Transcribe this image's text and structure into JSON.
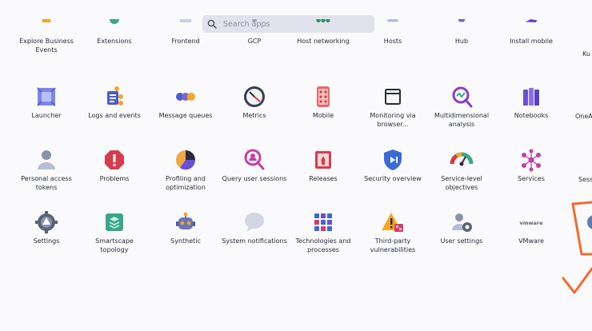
{
  "search": {
    "placeholder": "Search apps",
    "value": ""
  },
  "rows": [
    [
      {
        "label": "Explore Business Events",
        "icon": "business-events-icon"
      },
      {
        "label": "Extensions",
        "icon": "extensions-icon"
      },
      {
        "label": "Frontend",
        "icon": "frontend-icon"
      },
      {
        "label": "GCP",
        "icon": "gcp-icon"
      },
      {
        "label": "Host networking",
        "icon": "host-networking-icon"
      },
      {
        "label": "Hosts",
        "icon": "hosts-icon"
      },
      {
        "label": "Hub",
        "icon": "hub-icon"
      },
      {
        "label": "Install mobile",
        "icon": "install-mobile-icon"
      }
    ],
    [
      {
        "label": "Launcher",
        "icon": "launcher-icon"
      },
      {
        "label": "Logs and events",
        "icon": "logs-icon"
      },
      {
        "label": "Message queues",
        "icon": "message-queues-icon"
      },
      {
        "label": "Metrics",
        "icon": "metrics-icon"
      },
      {
        "label": "Mobile",
        "icon": "mobile-icon"
      },
      {
        "label": "Monitoring via browser...",
        "icon": "browser-monitor-icon"
      },
      {
        "label": "Multidimensional analysis",
        "icon": "multidimensional-icon"
      },
      {
        "label": "Notebooks",
        "icon": "notebooks-icon"
      }
    ],
    [
      {
        "label": "Personal access tokens",
        "icon": "access-tokens-icon"
      },
      {
        "label": "Problems",
        "icon": "problems-icon"
      },
      {
        "label": "Profiling and optimization",
        "icon": "profiling-icon"
      },
      {
        "label": "Query user sessions",
        "icon": "query-sessions-icon"
      },
      {
        "label": "Releases",
        "icon": "releases-icon"
      },
      {
        "label": "Security overview",
        "icon": "security-icon"
      },
      {
        "label": "Service-level objectives",
        "icon": "slo-icon"
      },
      {
        "label": "Services",
        "icon": "services-icon"
      }
    ],
    [
      {
        "label": "Settings",
        "icon": "settings-icon"
      },
      {
        "label": "Smartscape topology",
        "icon": "smartscape-icon"
      },
      {
        "label": "Synthetic",
        "icon": "synthetic-icon"
      },
      {
        "label": "System notifications",
        "icon": "notifications-icon"
      },
      {
        "label": "Technologies and processes",
        "icon": "technologies-icon"
      },
      {
        "label": "Third-party vulnerabilities",
        "icon": "vulnerabilities-icon"
      },
      {
        "label": "User settings",
        "icon": "user-settings-icon"
      },
      {
        "label": "VMware",
        "icon": "vmware-icon"
      }
    ]
  ],
  "edge": {
    "right_row1": "Ku",
    "right_row2": "OneA",
    "right_row3": "Sess"
  },
  "vmware_logo_text": "vmware"
}
